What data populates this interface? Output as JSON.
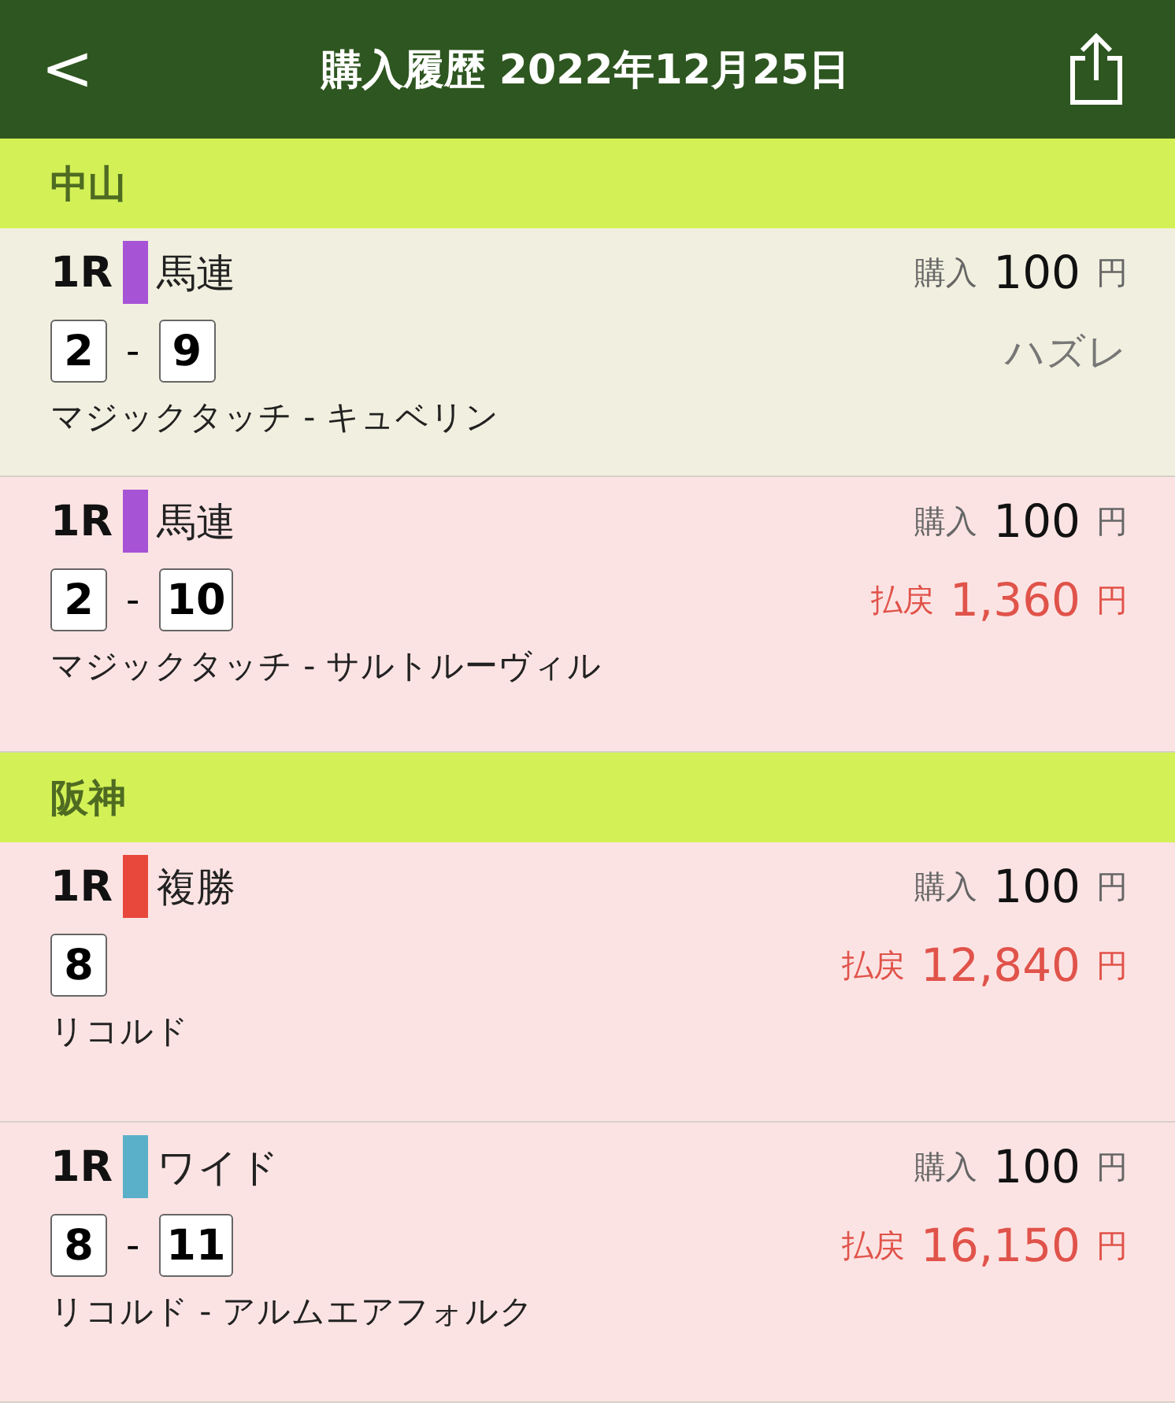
{
  "header": {
    "back": "<",
    "title": "購入履歴 2022年12月25日"
  },
  "sections": [
    {
      "venue": "中山",
      "tickets": [
        {
          "race": "1R",
          "color": "#a653d6",
          "bet_type": "馬連",
          "numbers": [
            "2",
            "9"
          ],
          "separator": "-",
          "purchase_label": "購入",
          "purchase_amount": "100",
          "purchase_currency": "円",
          "result": {
            "kind": "miss",
            "text": "ハズレ"
          },
          "horses": "マジックタッチ - キュベリン"
        },
        {
          "race": "1R",
          "color": "#a653d6",
          "bet_type": "馬連",
          "numbers": [
            "2",
            "10"
          ],
          "separator": "-",
          "purchase_label": "購入",
          "purchase_amount": "100",
          "purchase_currency": "円",
          "result": {
            "kind": "payout",
            "label": "払戻",
            "amount": "1,360",
            "currency": "円"
          },
          "horses": "マジックタッチ - サルトルーヴィル"
        }
      ]
    },
    {
      "venue": "阪神",
      "tickets": [
        {
          "race": "1R",
          "color": "#e8483c",
          "bet_type": "複勝",
          "numbers": [
            "8"
          ],
          "purchase_label": "購入",
          "purchase_amount": "100",
          "purchase_currency": "円",
          "result": {
            "kind": "payout",
            "label": "払戻",
            "amount": "12,840",
            "currency": "円"
          },
          "horses": "リコルド"
        },
        {
          "race": "1R",
          "color": "#5ab0c9",
          "bet_type": "ワイド",
          "numbers": [
            "8",
            "11"
          ],
          "separator": "-",
          "purchase_label": "購入",
          "purchase_amount": "100",
          "purchase_currency": "円",
          "result": {
            "kind": "payout",
            "label": "払戻",
            "amount": "16,150",
            "currency": "円"
          },
          "horses": "リコルド - アルムエアフォルク"
        }
      ]
    }
  ]
}
